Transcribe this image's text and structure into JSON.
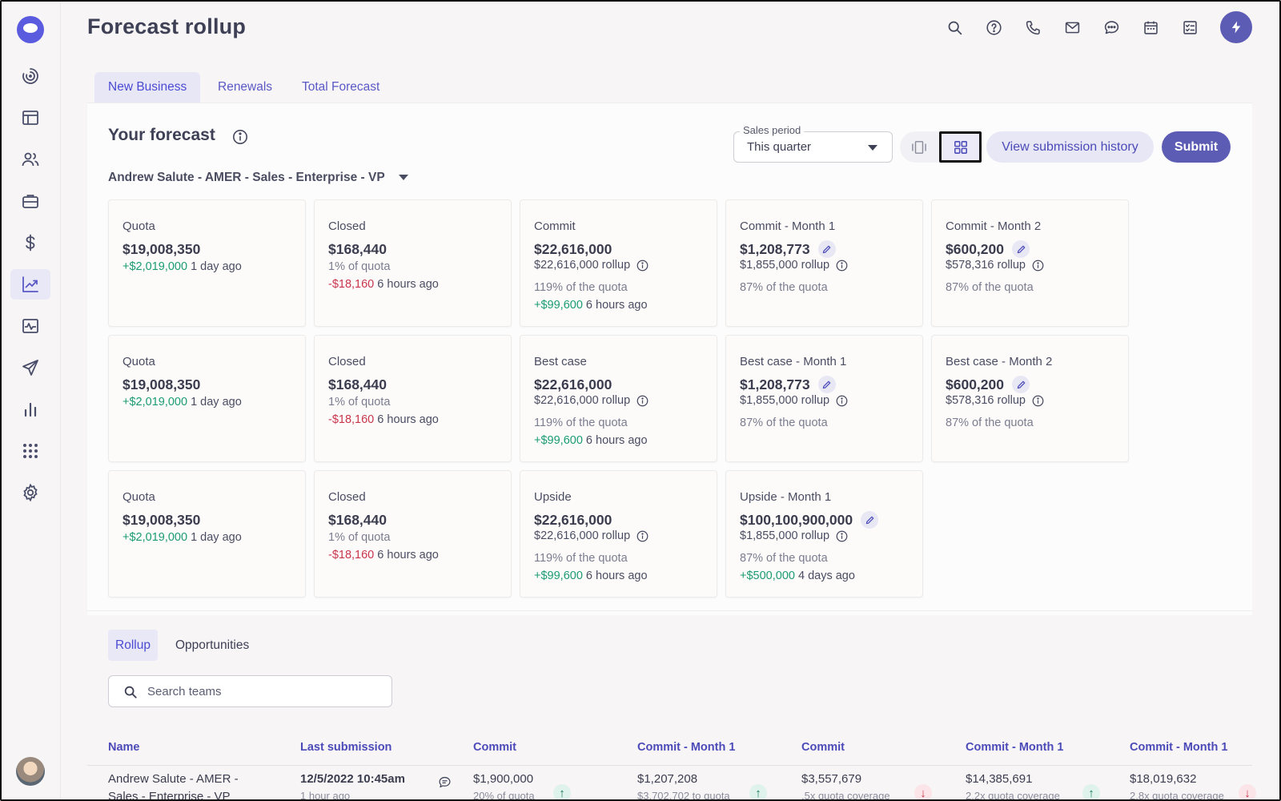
{
  "page": {
    "title": "Forecast rollup"
  },
  "colors": {
    "accent": "#5d5cb5",
    "positive": "#1a9b73",
    "negative": "#c8354b",
    "tab_active_bg": "#e8e7f6"
  },
  "sidebar": {
    "items": [
      {
        "icon": "dashboard-spiral-icon"
      },
      {
        "icon": "layout-icon"
      },
      {
        "icon": "people-icon"
      },
      {
        "icon": "briefcase-icon"
      },
      {
        "icon": "dollar-icon"
      },
      {
        "icon": "trend-chart-icon",
        "active": true
      },
      {
        "icon": "activity-monitor-icon"
      },
      {
        "icon": "send-icon"
      },
      {
        "icon": "bar-chart-icon"
      },
      {
        "icon": "apps-grid-icon"
      },
      {
        "icon": "settings-gear-icon"
      }
    ]
  },
  "top_icons": [
    "search-icon",
    "help-icon",
    "phone-icon",
    "mail-icon",
    "chat-icon",
    "calendar-icon",
    "tasks-icon",
    "bolt-icon"
  ],
  "tabs": [
    {
      "label": "New Business",
      "active": true
    },
    {
      "label": "Renewals",
      "active": false
    },
    {
      "label": "Total Forecast",
      "active": false
    }
  ],
  "forecast": {
    "title": "Your forecast",
    "hierarchy": "Andrew Salute - AMER - Sales - Enterprise - VP",
    "sales_period": {
      "label": "Sales period",
      "value": "This quarter"
    },
    "view_history_label": "View submission history",
    "submit_label": "Submit"
  },
  "cards": [
    [
      {
        "title": "Quota",
        "value": "$19,008,350",
        "line1": {
          "delta": "+$2,019,000",
          "tone": "pos",
          "text": "1 day ago"
        }
      },
      {
        "title": "Closed",
        "value": "$168,440",
        "line1": {
          "text": "1% of quota"
        },
        "line2": {
          "delta": "-$18,160",
          "tone": "neg",
          "text": "6 hours ago"
        }
      },
      {
        "title": "Commit",
        "value": "$22,616,000",
        "rollup": "$22,616,000",
        "rollup_label": "rollup",
        "pct": "119% of the quota",
        "line3": {
          "delta": "+$99,600",
          "tone": "pos",
          "text": "6 hours ago"
        }
      },
      {
        "title": "Commit - Month 1",
        "value": "$1,208,773",
        "editable": true,
        "rollup": "$1,855,000",
        "rollup_label": "rollup",
        "pct": "87% of the quota"
      },
      {
        "title": "Commit - Month 2",
        "value": "$600,200",
        "editable": true,
        "rollup": "$578,316",
        "rollup_label": "rollup",
        "pct": "87% of the quota"
      }
    ],
    [
      {
        "title": "Quota",
        "value": "$19,008,350",
        "line1": {
          "delta": "+$2,019,000",
          "tone": "pos",
          "text": "1 day ago"
        }
      },
      {
        "title": "Closed",
        "value": "$168,440",
        "line1": {
          "text": "1% of quota"
        },
        "line2": {
          "delta": "-$18,160",
          "tone": "neg",
          "text": "6 hours ago"
        }
      },
      {
        "title": "Best case",
        "value": "$22,616,000",
        "rollup": "$22,616,000",
        "rollup_label": "rollup",
        "pct": "119% of the quota",
        "line3": {
          "delta": "+$99,600",
          "tone": "pos",
          "text": "6 hours ago"
        }
      },
      {
        "title": "Best case - Month 1",
        "value": "$1,208,773",
        "editable": true,
        "rollup": "$1,855,000",
        "rollup_label": "rollup",
        "pct": "87% of the quota"
      },
      {
        "title": "Best case - Month 2",
        "value": "$600,200",
        "editable": true,
        "rollup": "$578,316",
        "rollup_label": "rollup",
        "pct": "87% of the quota"
      }
    ],
    [
      {
        "title": "Quota",
        "value": "$19,008,350",
        "line1": {
          "delta": "+$2,019,000",
          "tone": "pos",
          "text": "1 day ago"
        }
      },
      {
        "title": "Closed",
        "value": "$168,440",
        "line1": {
          "text": "1% of quota"
        },
        "line2": {
          "delta": "-$18,160",
          "tone": "neg",
          "text": "6 hours ago"
        }
      },
      {
        "title": "Upside",
        "value": "$22,616,000",
        "rollup": "$22,616,000",
        "rollup_label": "rollup",
        "pct": "119% of the quota",
        "line3": {
          "delta": "+$99,600",
          "tone": "pos",
          "text": "6 hours ago"
        }
      },
      {
        "title": "Upside - Month 1",
        "value": "$100,100,900,000",
        "editable": true,
        "rollup": "$1,855,000",
        "rollup_label": "rollup",
        "pct": "87% of the quota",
        "line3": {
          "delta": "+$500,000",
          "tone": "pos",
          "text": "4 days ago"
        }
      }
    ]
  ],
  "subtabs": [
    {
      "label": "Rollup",
      "active": true
    },
    {
      "label": "Opportunities",
      "active": false
    }
  ],
  "search": {
    "placeholder": "Search teams",
    "value": ""
  },
  "table": {
    "columns": [
      "Name",
      "Last submission",
      "Commit",
      "Commit - Month 1",
      "Commit",
      "Commit - Month 1",
      "Commit - Month 1"
    ],
    "rows": [
      {
        "name": "Andrew Salute - AMER -",
        "name_line2": "Sales - Enterprise - VP",
        "last_submission": "12/5/2022 10:45am",
        "last_submission_sub": "1 hour ago",
        "values": [
          {
            "value": "$1,900,000",
            "sub": "20% of quota",
            "trend": "up"
          },
          {
            "value": "$1,207,208",
            "sub": "$3,702,702 to quota",
            "trend": "up"
          },
          {
            "value": "$3,557,679",
            "sub": ".5x quota coverage",
            "trend": "down"
          },
          {
            "value": "$14,385,691",
            "sub": "2.2x quota coverage",
            "trend": "up"
          },
          {
            "value": "$18,019,632",
            "sub": "2.8x quota coverage",
            "trend": "down"
          }
        ]
      }
    ]
  }
}
